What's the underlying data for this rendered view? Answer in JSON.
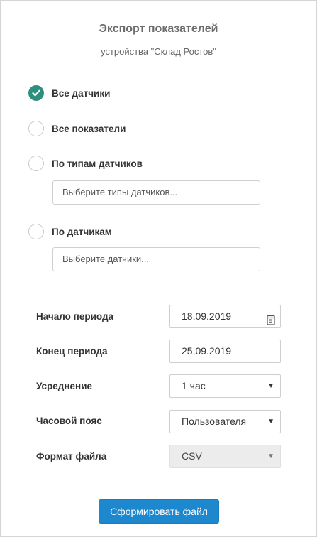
{
  "dialog": {
    "title": "Экспорт показателей",
    "subtitle": "устройства \"Склад Ростов\""
  },
  "options": [
    {
      "label": "Все датчики",
      "checked": true
    },
    {
      "label": "Все показатели",
      "checked": false
    },
    {
      "label": "По типам датчиков",
      "checked": false
    },
    {
      "label": "По датчикам",
      "checked": false
    }
  ],
  "sensor_types_input": {
    "placeholder": "Выберите типы датчиков..."
  },
  "sensors_input": {
    "placeholder": "Выберите датчики..."
  },
  "form": {
    "start": {
      "label": "Начало периода",
      "value": "18.09.2019"
    },
    "end": {
      "label": "Конец периода",
      "value": "25.09.2019"
    },
    "averaging": {
      "label": "Усреднение",
      "value": "1 час"
    },
    "timezone": {
      "label": "Часовой пояс",
      "value": "Пользователя"
    },
    "file_format": {
      "label": "Формат файла",
      "value": "CSV"
    }
  },
  "submit_label": "Сформировать файл",
  "colors": {
    "accent": "#2e8f7e",
    "button": "#1e88cf"
  },
  "icons": {
    "check": "checkmark-icon",
    "calendar": "calendar-icon",
    "dropdown": "caret-down-icon"
  }
}
